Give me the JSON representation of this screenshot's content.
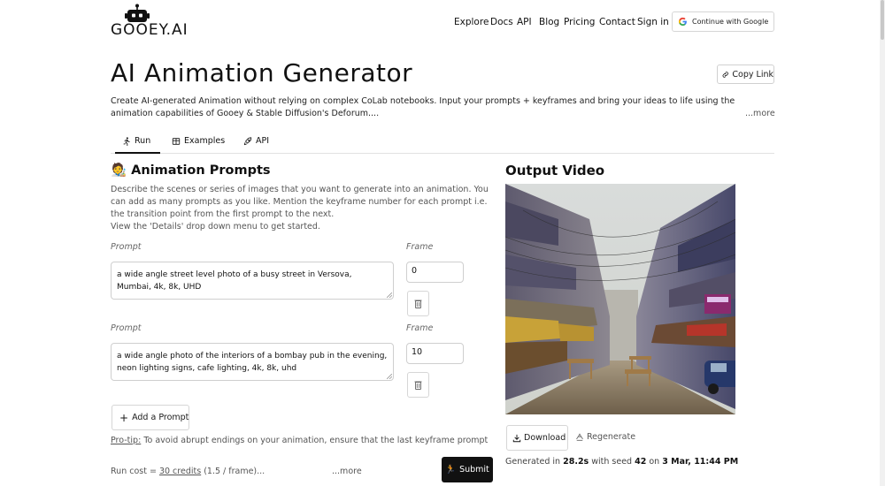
{
  "header": {
    "logo_text": "GOOEY.AI",
    "nav": [
      {
        "label": "Explore"
      },
      {
        "label": "Docs"
      },
      {
        "label": "API"
      },
      {
        "label": "Blog"
      },
      {
        "label": "Pricing"
      },
      {
        "label": "Contact"
      },
      {
        "label": "Sign in"
      }
    ],
    "google_button": "Continue with Google"
  },
  "page": {
    "title": "AI Animation Generator",
    "copy_link": "Copy Link",
    "description": "Create AI-generated Animation without relying on complex CoLab notebooks. Input your prompts + keyframes and bring your ideas to life using the animation capabilities of Gooey & Stable Diffusion's Deforum....",
    "more": "...more"
  },
  "tabs": [
    {
      "label": "Run",
      "icon": "run-icon",
      "active": true
    },
    {
      "label": "Examples",
      "icon": "examples-icon"
    },
    {
      "label": "API",
      "icon": "rocket-icon"
    }
  ],
  "prompts_section": {
    "emoji": "🧑‍🎨",
    "title": "Animation Prompts",
    "description_lines": [
      "Describe the scenes or series of images that you want to generate into an animation. You can add as many prompts as you like. Mention the keyframe number for each prompt i.e. the transition point from the first prompt to the next.",
      "View the 'Details' drop down menu to get started."
    ],
    "prompt_label": "Prompt",
    "frame_label": "Frame",
    "prompts": [
      {
        "text": "a wide angle street level photo of a busy street in Versova, Mumbai, 4k, 8k, UHD",
        "frame": "0"
      },
      {
        "text": "a wide angle photo of the interiors of a bombay pub in the evening, neon lighting signs, cafe lighting, 4k, 8k, uhd",
        "frame": "10"
      }
    ],
    "add_button": "Add a Prompt",
    "tip_prefix": "Pro-tip:",
    "tip_text": "To avoid abrupt endings on your animation, ensure that the last keyframe prompt is set for",
    "cost_prefix": "Run cost = ",
    "cost_credits": "30 credits",
    "cost_suffix": " (1.5 / frame)...",
    "more": "...more",
    "submit_emoji": "🏃",
    "submit": "Submit"
  },
  "output": {
    "title": "Output Video",
    "download": "Download",
    "regenerate": "Regenerate",
    "generated_prefix": "Generated in ",
    "time": "28.2s",
    "seed_prefix": " with seed ",
    "seed": "42",
    "date_prefix": " on ",
    "date": "3 Mar, 11:44 PM"
  }
}
